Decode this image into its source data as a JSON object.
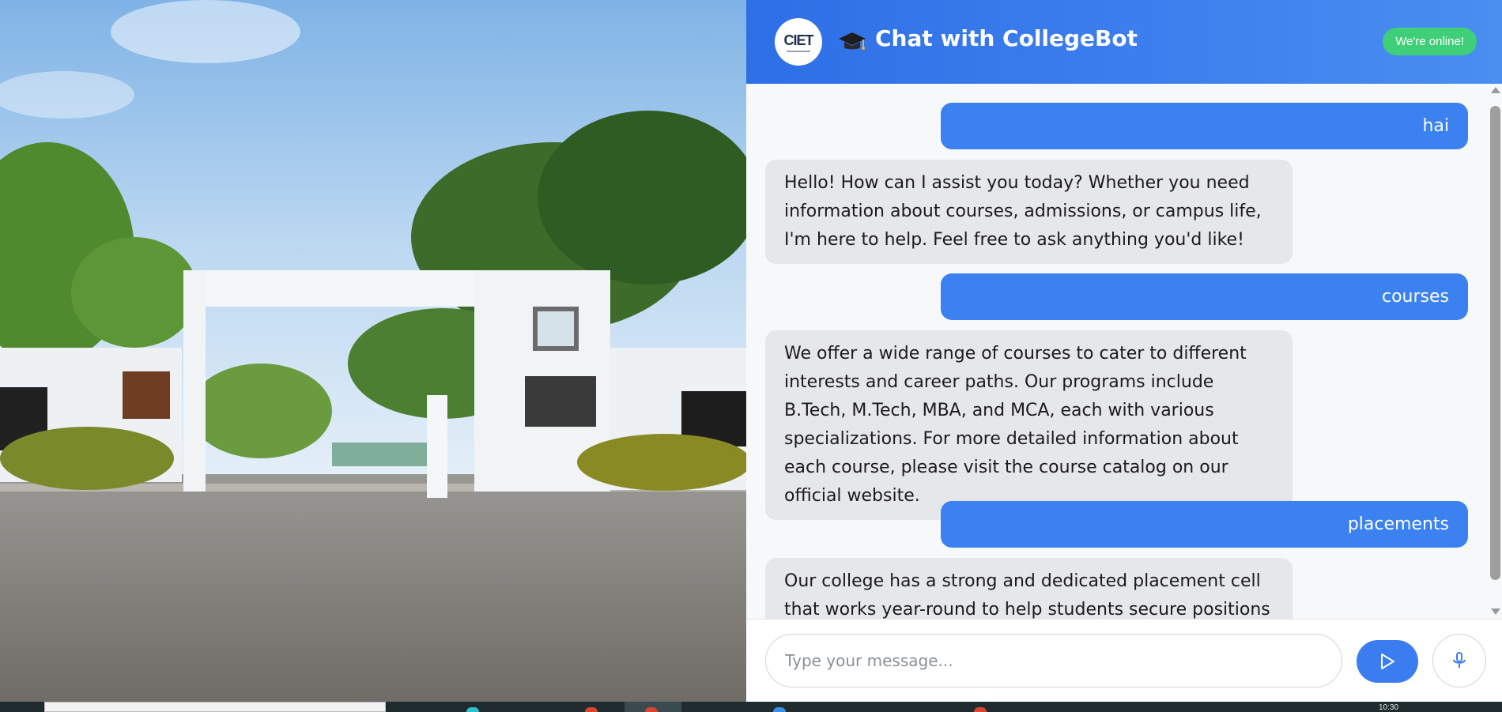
{
  "header": {
    "logo_text": "CIET",
    "title": "Chat with CollegeBot",
    "status_badge": "We're online!"
  },
  "messages": [
    {
      "role": "user",
      "text": "hai"
    },
    {
      "role": "bot",
      "text": "Hello! How can I assist you today? Whether you need information about courses, admissions, or campus life, I'm here to help. Feel free to ask anything you'd like!"
    },
    {
      "role": "user",
      "text": "courses"
    },
    {
      "role": "bot",
      "text": "We offer a wide range of courses to cater to different interests and career paths. Our programs include B.Tech, M.Tech, MBA, and MCA, each with various specializations. For more detailed information about each course, please visit the course catalog on our official website."
    },
    {
      "role": "user",
      "text": "placements"
    },
    {
      "role": "bot",
      "text": "Our college has a strong and dedicated placement cell that works year-round to help students secure positions in"
    }
  ],
  "input": {
    "placeholder": "Type your message...",
    "value": ""
  },
  "taskbar": {
    "clock": "10:30"
  },
  "icons": {
    "header_icon": "graduation-cap-icon",
    "send": "send-play-icon",
    "mic": "microphone-icon"
  },
  "colors": {
    "header_gradient_start": "#2f6fe6",
    "header_gradient_end": "#4a8ef0",
    "user_bubble": "#3b82f0",
    "bot_bubble": "#e6e7ea",
    "online_badge": "#3fcf78"
  }
}
